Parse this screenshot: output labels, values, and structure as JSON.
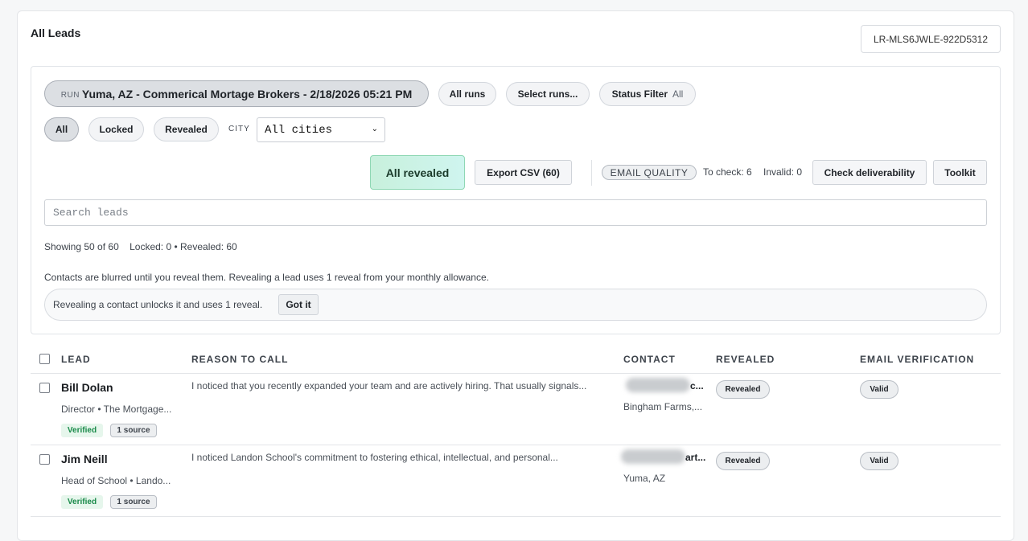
{
  "header": {
    "title": "All Leads",
    "list_code": "LR-MLS6JWLE-922D5312"
  },
  "filters": {
    "run_tag": "RUN",
    "run_label": "Yuma, AZ - Commerical Mortage Brokers - 2/18/2026 05:21 PM",
    "all_runs": "All runs",
    "select_runs": "Select runs...",
    "status_filter_label": "Status Filter",
    "status_filter_value": "All",
    "segments": [
      "All",
      "Locked",
      "Revealed"
    ],
    "city_label": "CITY",
    "city_value": "All cities"
  },
  "actions": {
    "all_revealed": "All revealed",
    "export_csv": "Export CSV (60)",
    "email_quality": "EMAIL QUALITY",
    "to_check": "To check: 6",
    "invalid": "Invalid: 0",
    "check_deliverability": "Check deliverability",
    "toolkit": "Toolkit"
  },
  "search": {
    "placeholder": "Search leads"
  },
  "summary": {
    "showing": "Showing 50 of 60",
    "counts": "Locked: 0 • Revealed: 60"
  },
  "notice": {
    "info": "Contacts are blurred until you reveal them. Revealing a lead uses 1 reveal from your monthly allowance.",
    "banner": "Revealing a contact unlocks it and uses 1 reveal.",
    "got_it": "Got it"
  },
  "table": {
    "columns": [
      "LEAD",
      "REASON TO CALL",
      "CONTACT",
      "REVEALED",
      "EMAIL VERIFICATION"
    ],
    "rows": [
      {
        "name": "Bill Dolan",
        "title": "Director • The Mortgage...",
        "verified": "Verified",
        "sources": "1 source",
        "reason": "I noticed that you recently expanded your team and are actively hiring. That usually signals...",
        "contact_tail": "c...",
        "contact_location": "Bingham Farms,...",
        "revealed": "Revealed",
        "email_verification": "Valid"
      },
      {
        "name": "Jim Neill",
        "title": "Head of School • Lando...",
        "verified": "Verified",
        "sources": "1 source",
        "reason": "I noticed Landon School's commitment to fostering ethical, intellectual, and personal...",
        "contact_tail": "art...",
        "contact_location": "Yuma, AZ",
        "revealed": "Revealed",
        "email_verification": "Valid"
      }
    ]
  }
}
